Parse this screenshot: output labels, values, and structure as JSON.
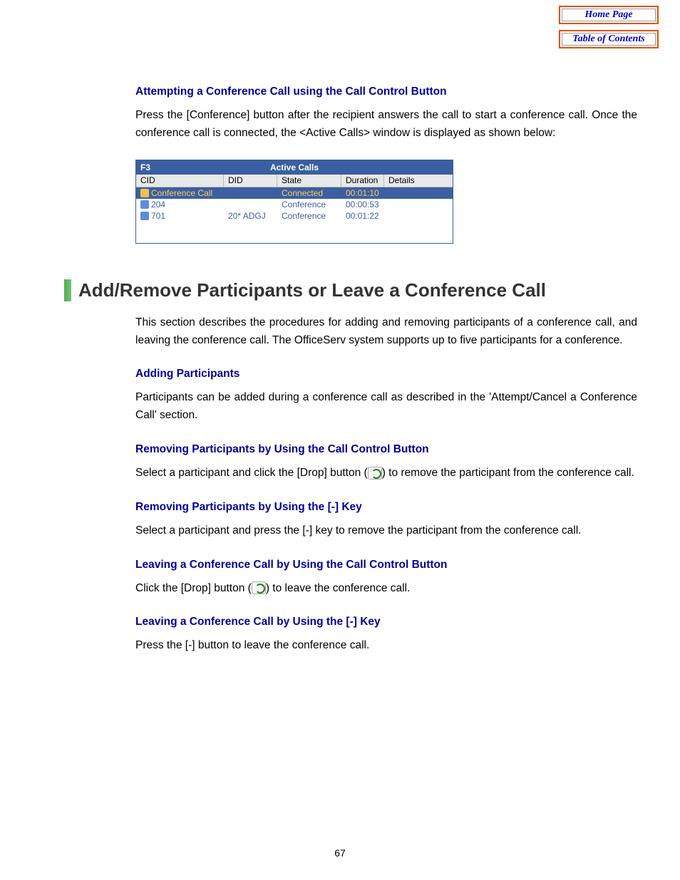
{
  "nav": {
    "home": "Home Page",
    "toc": "Table of Contents"
  },
  "sec1": {
    "heading": "Attempting a Conference Call using the Call Control Button",
    "body": "Press the [Conference] button after the recipient answers the call to start a conference call. Once the conference call is connected, the <Active Calls> window is displayed as shown below:"
  },
  "active_calls": {
    "fkey": "F3",
    "title": "Active Calls",
    "columns": {
      "cid": "CID",
      "did": "DID",
      "state": "State",
      "duration": "Duration",
      "details": "Details"
    },
    "rows": [
      {
        "cid": "Conference Call",
        "did": "",
        "state": "Connected",
        "duration": "00:01:10",
        "details": "",
        "selected": true
      },
      {
        "cid": "204",
        "did": "",
        "state": "Conference",
        "duration": "00:00:53",
        "details": "",
        "selected": false
      },
      {
        "cid": "701",
        "did": "20* ADGJ",
        "state": "Conference",
        "duration": "00:01:22",
        "details": "",
        "selected": false
      }
    ]
  },
  "section_heading": "Add/Remove Participants or Leave a Conference Call",
  "section_intro": "This section describes the procedures for adding and removing participants of a conference call, and leaving the conference call. The OfficeServ system supports up to five participants for a conference.",
  "adding": {
    "heading": "Adding Participants",
    "body": "Participants can be added during a conference call as described in the 'Attempt/Cancel a Conference Call' section."
  },
  "remove_btn": {
    "heading": "Removing Participants by Using the Call Control Button",
    "body_pre": "Select a participant and click the [Drop] button (",
    "body_post": ") to remove the participant from the conference call."
  },
  "remove_key": {
    "heading": "Removing Participants by Using the [-] Key",
    "body": "Select a participant and press the [-] key to remove the participant from the conference call."
  },
  "leave_btn": {
    "heading": "Leaving a Conference Call by Using the Call Control Button",
    "body_pre": "Click the [Drop] button (",
    "body_post": ") to leave the conference call."
  },
  "leave_key": {
    "heading": "Leaving a Conference Call by Using the [-] Key",
    "body": "Press the [-] button to leave the conference call."
  },
  "page_number": "67"
}
